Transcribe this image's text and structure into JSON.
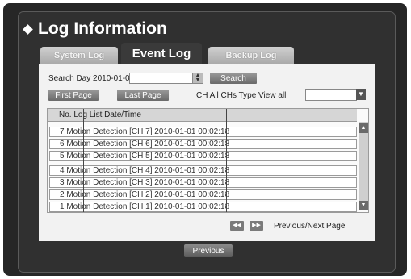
{
  "window": {
    "title": "Log Information"
  },
  "tabs": [
    {
      "label": "System Log"
    },
    {
      "label": "Event Log"
    },
    {
      "label": "Backup Log"
    }
  ],
  "search": {
    "label": "Search Day 2010-01-01",
    "button": "Search"
  },
  "paging": {
    "first": "First Page",
    "last": "Last Page",
    "channel_label": "CH All CHs Type View all",
    "channel_value": "",
    "prev_next_label": "Previous/Next Page"
  },
  "list": {
    "header": "No. Log List Date/Time",
    "rows": [
      "7 Motion Detection [CH 7] 2010-01-01 00:02:18",
      "6 Motion Detection [CH 6] 2010-01-01 00:02:18",
      "5 Motion Detection [CH 5] 2010-01-01 00:02:18",
      "4 Motion Detection [CH 4] 2010-01-01 00:02:18",
      "3 Motion Detection [CH 3] 2010-01-01 00:02:18",
      "2 Motion Detection [CH 2] 2010-01-01 00:02:18",
      "1 Motion Detection [CH 1] 2010-01-01 00:02:18"
    ]
  },
  "footer": {
    "previous": "Previous"
  },
  "colors": {
    "background": "#262626",
    "panel": "#f2f2f2",
    "button": "#7a7a7a"
  }
}
